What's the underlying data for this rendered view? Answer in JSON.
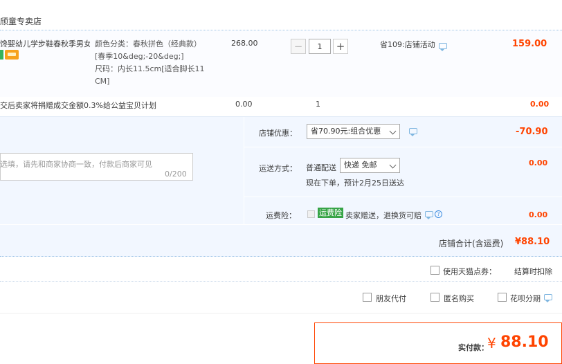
{
  "shop": {
    "name": "颀童专卖店"
  },
  "item": {
    "name": "馋婴幼儿学步鞋春秋季男女...",
    "sku_line1": "颜色分类：春秋拼色（经典款）",
    "sku_line2": "[春季10&deg;-20&deg;]",
    "sku_line3": "尺码：内长11.5cm[适合脚长11",
    "sku_line4": "CM]",
    "unit_price": "268.00",
    "qty_minus": "−",
    "qty": "1",
    "qty_plus": "+",
    "promo": "省109:店铺活动",
    "subtotal": "159.00"
  },
  "donation": {
    "text": "交后卖家将捐赠成交金额0.3%给公益宝贝计划",
    "price": "0.00",
    "qty": "1",
    "subtotal": "0.00"
  },
  "message": {
    "placeholder": "选填，请先和商家协商一致，付款后商家可见",
    "counter": "0/200"
  },
  "discount": {
    "label": "店铺优惠：",
    "selected": "省70.90元:组合优惠",
    "amount": "-70.90"
  },
  "shipping": {
    "label": "运送方式：",
    "method": "普通配送",
    "selected": "快递 免邮",
    "note": "现在下单，预计2月25日送达",
    "amount": "0.00"
  },
  "insurance": {
    "label": "运费险：",
    "badge": "运费险",
    "text": "卖家赠送，退换货可赔",
    "help": "?",
    "amount": "0.00"
  },
  "shop_total": {
    "label": "店铺合计(含运费)",
    "value": "¥88.10"
  },
  "options": {
    "tmall_points": "使用天猫点券：",
    "settle_note": "结算时扣除",
    "friend_pay": "朋友代付",
    "anonymous": "匿名购买",
    "huabei": "花呗分期"
  },
  "payment": {
    "label": "实付款：",
    "currency": "¥",
    "value": "88.10"
  },
  "colors": {
    "accent": "#ff4400",
    "panel": "#f2f7ff",
    "insurance_badge": "#37a447"
  }
}
